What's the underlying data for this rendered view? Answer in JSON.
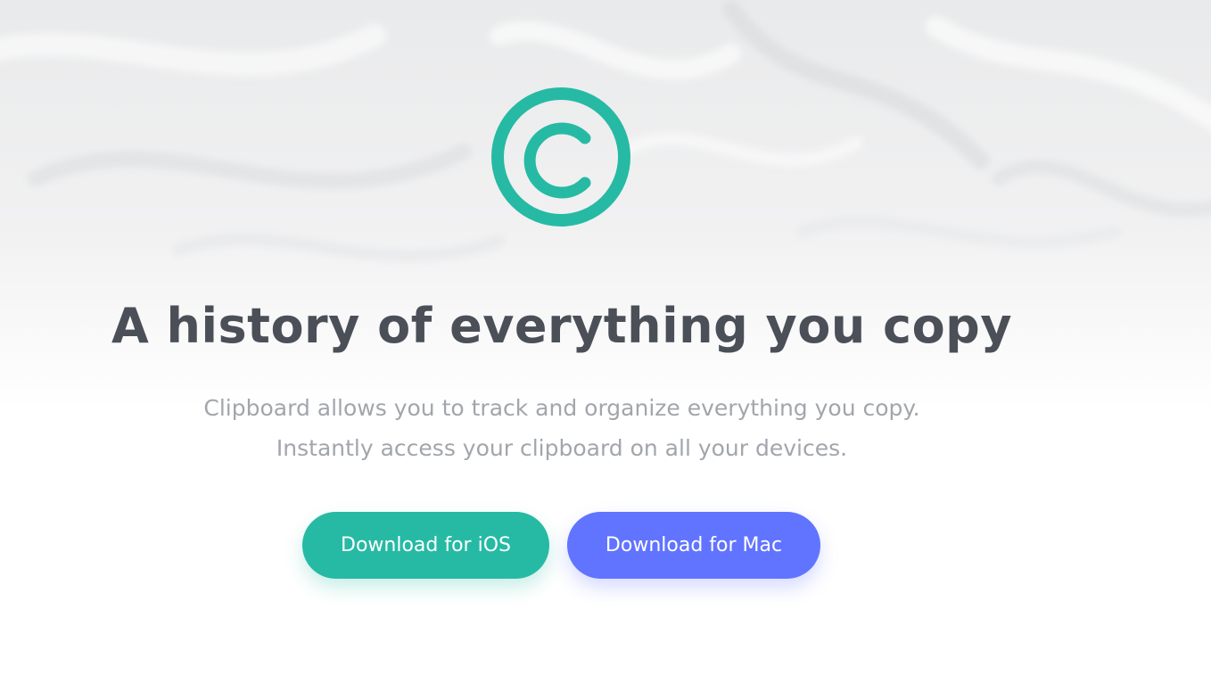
{
  "hero": {
    "logo_icon": "copyright-c-icon",
    "title": "A history of everything you copy",
    "subtitle_line1": "Clipboard allows you to track and organize everything you copy.",
    "subtitle_line2": "Instantly access your clipboard on all your devices."
  },
  "buttons": {
    "ios_label": "Download for iOS",
    "mac_label": "Download for Mac"
  },
  "colors": {
    "accent_teal": "#26baa4",
    "accent_blue": "#6174ff",
    "title_text": "#4b4f57",
    "subtitle_text": "#a2a6ab"
  }
}
